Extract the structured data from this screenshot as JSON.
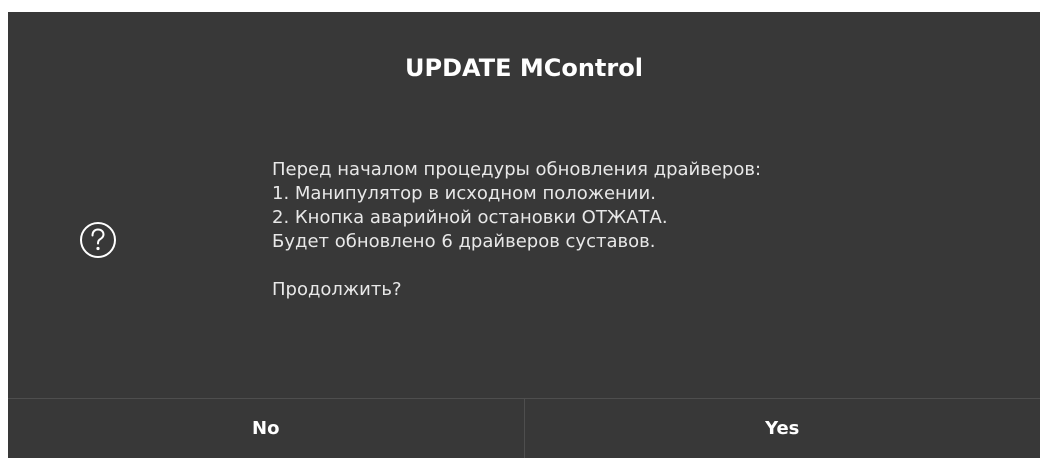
{
  "dialog": {
    "title": "UPDATE MControl",
    "icon": "question-circle-icon",
    "message": {
      "line1": "Перед началом процедуры обновления драйверов:",
      "line2": "1. Манипулятор в исходном положении.",
      "line3": "2. Кнопка аварийной остановки ОТЖАТА.",
      "line4": "Будет обновлено 6 драйверов суставов.",
      "line5": "Продолжить?"
    },
    "buttons": {
      "no_label": "No",
      "yes_label": "Yes"
    }
  },
  "colors": {
    "background": "#383838",
    "text": "#f2f2f2",
    "divider": "#4e4e4e"
  }
}
